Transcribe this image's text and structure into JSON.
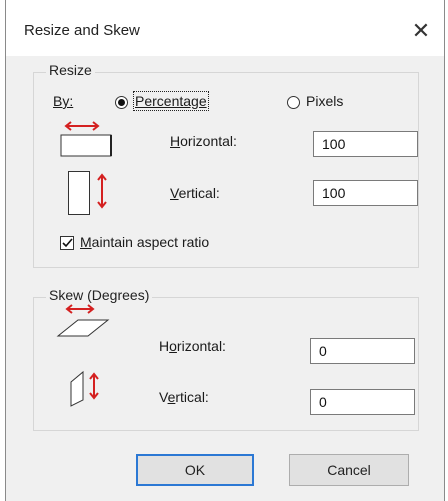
{
  "window": {
    "title": "Resize and Skew",
    "close_glyph": "✕"
  },
  "resize": {
    "group_title": "Resize",
    "by_label": "By:",
    "by_options": [
      {
        "label": "Percentage",
        "selected": true
      },
      {
        "label": "Pixels",
        "selected": false
      }
    ],
    "horizontal_label": "Horizontal:",
    "horizontal_value": "100",
    "vertical_label": "Vertical:",
    "vertical_value": "100",
    "maintain_aspect_label": "Maintain aspect ratio",
    "maintain_aspect_checked": true
  },
  "skew": {
    "group_title": "Skew (Degrees)",
    "horizontal_label": "Horizontal:",
    "horizontal_value": "0",
    "vertical_label": "Vertical:",
    "vertical_value": "0"
  },
  "buttons": {
    "ok_label": "OK",
    "cancel_label": "Cancel"
  },
  "colors": {
    "arrow_red": "#d42020",
    "default_button_border": "#2b78d4"
  },
  "icons": {
    "horizontal_resize": "horizontal-resize-icon",
    "vertical_resize": "vertical-resize-icon",
    "horizontal_skew": "horizontal-skew-icon",
    "vertical_skew": "vertical-skew-icon"
  }
}
